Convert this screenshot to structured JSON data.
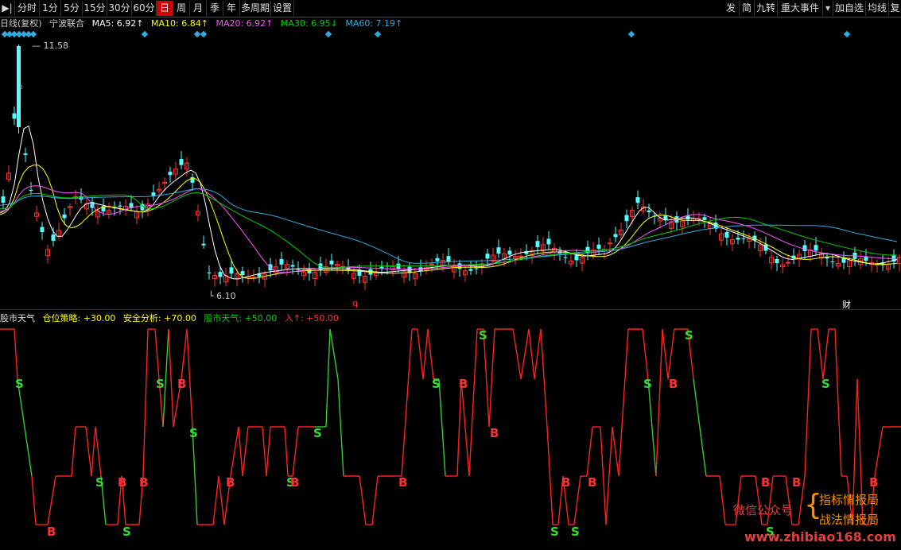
{
  "toolbar": {
    "icon": "play-step-icon",
    "left": [
      "分时",
      "1分",
      "5分",
      "15分",
      "30分",
      "60分",
      "日",
      "周",
      "月",
      "季",
      "年",
      "多周期",
      "设置"
    ],
    "active": "日",
    "right": [
      "发",
      "简",
      "九转",
      "重大事件",
      "加自选",
      "均线",
      "复"
    ]
  },
  "price_panel": {
    "title": "日线(复权)",
    "stock": "宁波联合",
    "ma5": "MA5: 6.92↑",
    "ma10": "MA10: 6.84↑",
    "ma20": "MA20: 6.92↑",
    "ma30": "MA30: 6.95↓",
    "ma60": "MA60: 7.19↑",
    "high_label": "11.58",
    "low_label": "6.10",
    "marker_q": "q",
    "marker_cai": "财",
    "colors": {
      "ma5": "#ffffff",
      "ma10": "#ffff00",
      "ma20": "#ff55ff",
      "ma30": "#00cc00",
      "ma60": "#33aadd",
      "up": "#ff3232",
      "down": "#54ffff"
    }
  },
  "indicator_panel": {
    "name": "股市天气",
    "strategy": "仓位策略: +30.00",
    "safety": "安全分析: +70.00",
    "weather": "股市天气: +50.00",
    "entry": "入↑: +50.00",
    "s_label": "S",
    "b_label": "B"
  },
  "watermark": {
    "wechat": "微信公众号",
    "name1": "指标情报局",
    "name2": "战法情报局",
    "site": "www.zhibiao168.com"
  }
}
